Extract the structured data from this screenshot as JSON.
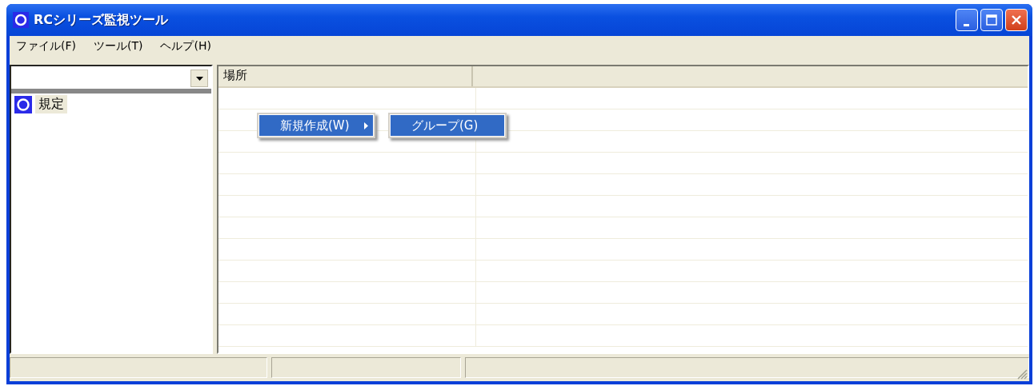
{
  "window": {
    "title": "RCシリーズ監視ツール"
  },
  "menu_bar": [
    {
      "label": "ファイル(F)"
    },
    {
      "label": "ツール(T)"
    },
    {
      "label": "ヘルプ(H)"
    }
  ],
  "tree": {
    "items": [
      {
        "label": "規定",
        "selected": true
      }
    ]
  },
  "list": {
    "columns": [
      "場所"
    ]
  },
  "context_menu": {
    "items": [
      {
        "label": "新規作成(W)",
        "selected": true,
        "has_submenu": true
      }
    ],
    "submenu": {
      "items": [
        {
          "label": "グループ(G)",
          "selected": true
        }
      ]
    }
  }
}
